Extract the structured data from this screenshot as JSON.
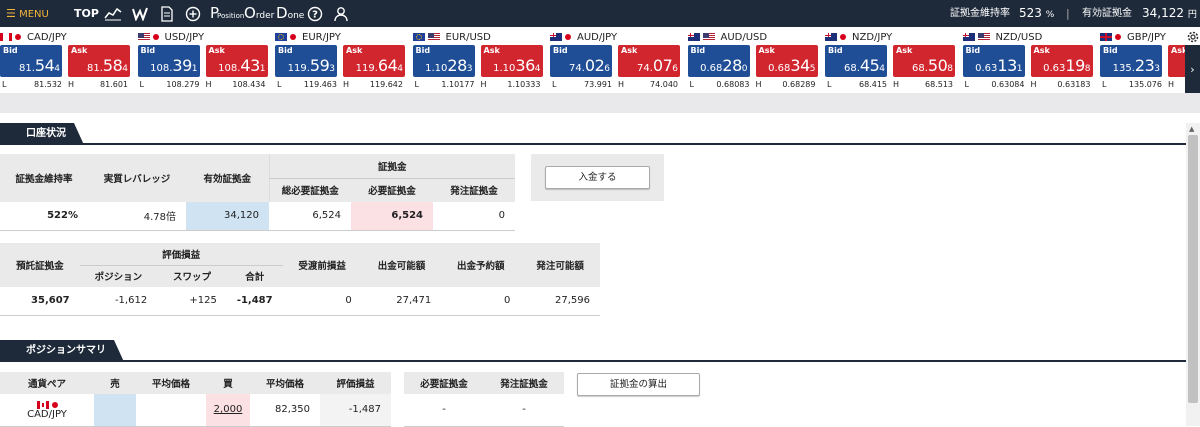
{
  "topbar": {
    "menu_label": "MENU",
    "top_label": "TOP",
    "nav_icons": [
      "chart-icon",
      "chart-w-icon",
      "document-icon",
      "plus-circle-icon",
      "position-icon",
      "order-icon",
      "done-icon",
      "help-icon",
      "user-icon"
    ],
    "position_label": "P",
    "position_sub": "Position",
    "order_label": "O",
    "order_sub": "rder",
    "done_label": "D",
    "done_sub": "one",
    "margin_ratio_label": "証拠金維持率",
    "margin_ratio_value": "523",
    "margin_ratio_unit": "%",
    "sep": "|",
    "effective_label": "有効証拠金",
    "effective_value": "34,122",
    "effective_unit": "円"
  },
  "ticker": [
    {
      "pair": "CAD/JPY",
      "bid": {
        "a": "81.",
        "b": "54",
        "c": "4"
      },
      "ask": {
        "a": "81.",
        "b": "58",
        "c": "4"
      },
      "low": "81.532",
      "high": "81.601"
    },
    {
      "pair": "USD/JPY",
      "bid": {
        "a": "108.",
        "b": "39",
        "c": "1"
      },
      "ask": {
        "a": "108.",
        "b": "43",
        "c": "1"
      },
      "low": "108.279",
      "high": "108.434"
    },
    {
      "pair": "EUR/JPY",
      "bid": {
        "a": "119.",
        "b": "59",
        "c": "3"
      },
      "ask": {
        "a": "119.",
        "b": "64",
        "c": "4"
      },
      "low": "119.463",
      "high": "119.642"
    },
    {
      "pair": "EUR/USD",
      "bid": {
        "a": "1.10",
        "b": "28",
        "c": "3"
      },
      "ask": {
        "a": "1.10",
        "b": "36",
        "c": "4"
      },
      "low": "1.10177",
      "high": "1.10333"
    },
    {
      "pair": "AUD/JPY",
      "bid": {
        "a": "74.",
        "b": "02",
        "c": "6"
      },
      "ask": {
        "a": "74.",
        "b": "07",
        "c": "6"
      },
      "low": "73.991",
      "high": "74.040"
    },
    {
      "pair": "AUD/USD",
      "bid": {
        "a": "0.68",
        "b": "28",
        "c": "0"
      },
      "ask": {
        "a": "0.68",
        "b": "34",
        "c": "5"
      },
      "low": "0.68083",
      "high": "0.68289"
    },
    {
      "pair": "NZD/JPY",
      "bid": {
        "a": "68.",
        "b": "45",
        "c": "4"
      },
      "ask": {
        "a": "68.",
        "b": "50",
        "c": "8"
      },
      "low": "68.415",
      "high": "68.513"
    },
    {
      "pair": "NZD/USD",
      "bid": {
        "a": "0.63",
        "b": "13",
        "c": "1"
      },
      "ask": {
        "a": "0.63",
        "b": "19",
        "c": "8"
      },
      "low": "0.63084",
      "high": "0.63183"
    },
    {
      "pair": "GBP/JPY",
      "bid": {
        "a": "135.",
        "b": "23",
        "c": "3"
      },
      "ask": {
        "a": "",
        "b": "",
        "c": ""
      },
      "low": "135.076",
      "high": ""
    }
  ],
  "ticker_labels": {
    "bid": "Bid",
    "ask": "Ask",
    "low": "L",
    "high": "H"
  },
  "ticker_next": "›",
  "colors": {
    "navy": "#1e2a3a",
    "bid": "#1f4e96",
    "ask": "#d2262f",
    "blue_cell": "#cfe3f3",
    "pink_cell": "#fbe0e4"
  },
  "account": {
    "section_title": "口座状況",
    "headers": {
      "margin_ratio": "証拠金維持率",
      "leverage": "実質レバレッジ",
      "effective": "有効証拠金",
      "margin_group": "証拠金",
      "total_required": "総必要証拠金",
      "required": "必要証拠金",
      "order_margin": "発注証拠金"
    },
    "values": {
      "margin_ratio": "522%",
      "leverage": "4.78倍",
      "effective": "34,120",
      "total_required": "6,524",
      "required": "6,524",
      "order_margin": "0"
    },
    "deposit_button": "入金する",
    "headers2": {
      "deposit": "預託証拠金",
      "pl_group": "評価損益",
      "position": "ポジション",
      "swap": "スワップ",
      "total": "合計",
      "unsettled": "受渡前損益",
      "withdrawable": "出金可能額",
      "withdraw_reserved": "出金予約額",
      "orderable": "発注可能額"
    },
    "values2": {
      "deposit": "35,607",
      "position": "-1,612",
      "swap": "+125",
      "total": "-1,487",
      "unsettled": "0",
      "withdrawable": "27,471",
      "withdraw_reserved": "0",
      "orderable": "27,596"
    }
  },
  "summary": {
    "section_title": "ポジションサマリ",
    "headers": {
      "pair": "通貨ペア",
      "sell": "売",
      "avg1": "平均価格",
      "buy": "買",
      "avg2": "平均価格",
      "pl": "評価損益",
      "required": "必要証拠金",
      "order_margin": "発注証拠金"
    },
    "row": {
      "pair": "CAD/JPY",
      "sell": "",
      "avg1": "",
      "buy": "2,000",
      "avg2": "82,350",
      "pl": "-1,487",
      "required": "-",
      "order_margin": "-"
    },
    "calc_button": "証拠金の算出"
  }
}
